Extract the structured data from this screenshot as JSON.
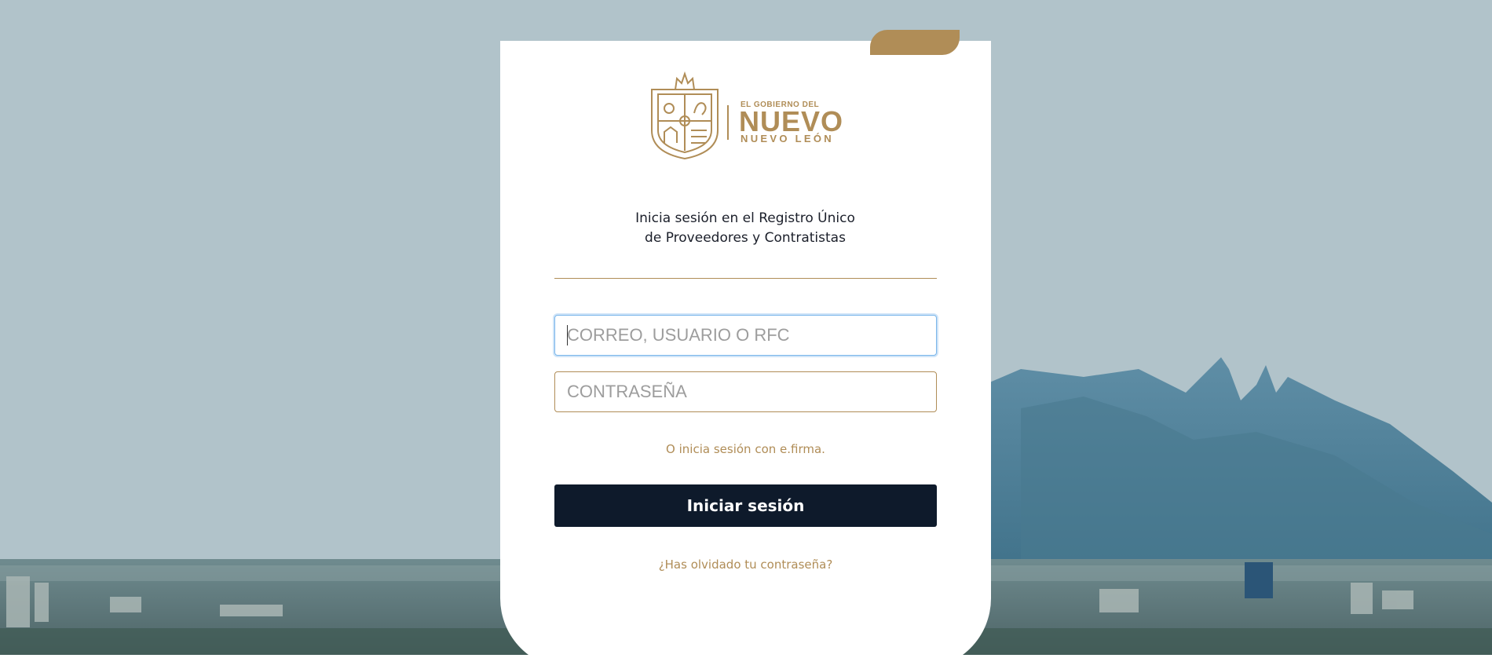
{
  "colors": {
    "gold": "#b08d57",
    "navy": "#0e1a2b",
    "sky": "#b1c3ca",
    "focus_blue": "#7ab6ea"
  },
  "logo": {
    "top_text": "EL GOBIERNO DEL",
    "main_text": "NUEVO",
    "sub_text": "NUEVO LEÓN",
    "emblem_icon": "coat-of-arms-icon"
  },
  "heading": {
    "line1": "Inicia sesión en el Registro Único",
    "line2": "de Proveedores y Contratistas"
  },
  "form": {
    "user_placeholder": "CORREO, USUARIO O RFC",
    "user_value": "",
    "password_placeholder": "CONTRASEÑA",
    "password_value": "",
    "efirma_link": "O inicia sesión con e.firma.",
    "submit_label": "Iniciar sesión",
    "forgot_link": "¿Has olvidado tu contraseña?"
  }
}
